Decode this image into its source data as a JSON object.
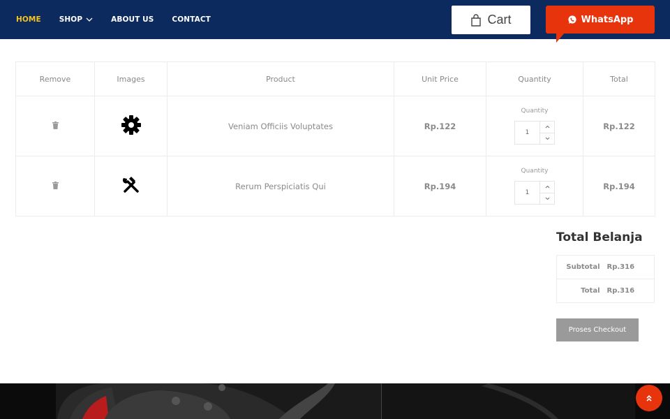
{
  "nav": {
    "items": [
      {
        "label": "HOME",
        "active": true
      },
      {
        "label": "SHOP",
        "has_dropdown": true
      },
      {
        "label": "ABOUT US"
      },
      {
        "label": "CONTACT"
      }
    ],
    "cart_label": "Cart",
    "whatsapp_label": "WhatsApp"
  },
  "cart_table": {
    "headers": [
      "Remove",
      "Images",
      "Product",
      "Unit Price",
      "Quantity",
      "Total"
    ],
    "rows": [
      {
        "image_icon": "gear-icon",
        "product": "Veniam Officiis Voluptates",
        "unit_price": "Rp.122",
        "quantity_label": "Quantity",
        "quantity": "1",
        "total": "Rp.122"
      },
      {
        "image_icon": "tools-icon",
        "product": "Rerum Perspiciatis Qui",
        "unit_price": "Rp.194",
        "quantity_label": "Quantity",
        "quantity": "1",
        "total": "Rp.194"
      }
    ]
  },
  "totals": {
    "title": "Total Belanja",
    "subtotal_label": "Subtotal",
    "subtotal_value": "Rp.316",
    "total_label": "Total",
    "total_value": "Rp.316",
    "checkout_label": "Proses Checkout"
  },
  "colors": {
    "navbar": "#0d2a5e",
    "nav_active": "#f6c21c",
    "accent": "#e8340c",
    "checkout_button": "#9a9a9a"
  },
  "icons": {
    "remove": "trash-icon",
    "cart": "shopping-bag-icon",
    "whatsapp": "whatsapp-icon",
    "scroll_top": "double-chevron-up-icon",
    "dropdown": "chevron-down-icon"
  }
}
